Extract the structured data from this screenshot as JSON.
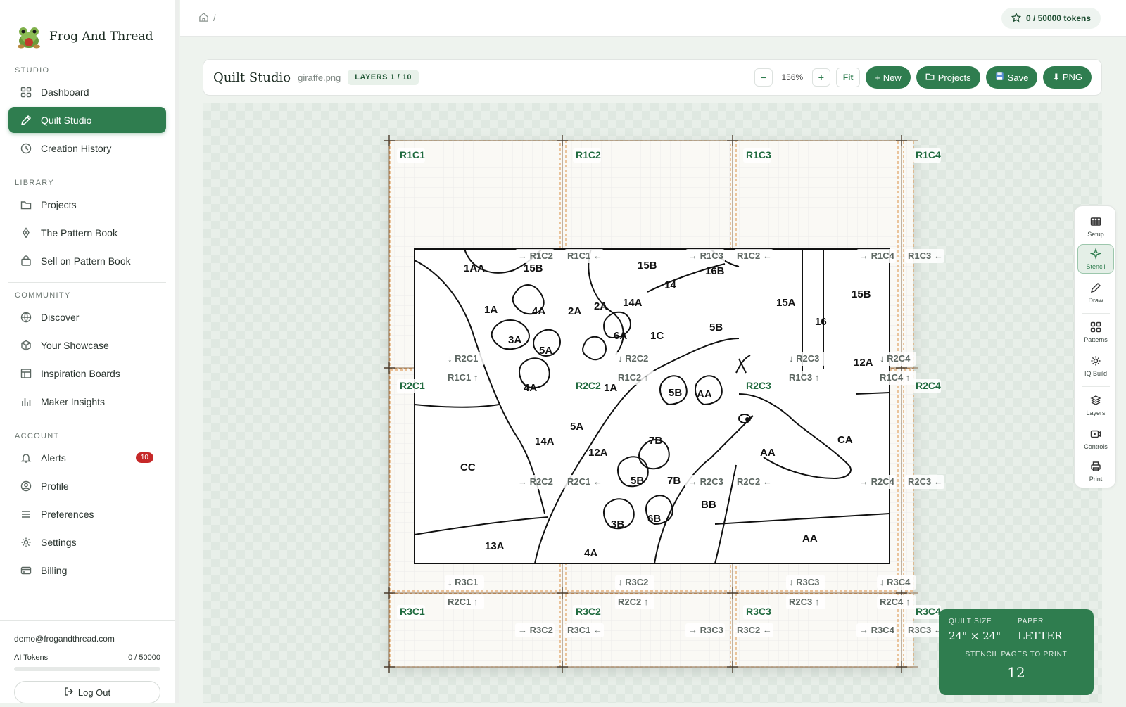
{
  "brand": {
    "name": "Frog And Thread"
  },
  "sidebar": {
    "studio_title": "STUDIO",
    "studio": [
      {
        "label": "Dashboard",
        "icon": "grid-icon"
      },
      {
        "label": "Quilt Studio",
        "icon": "pencil-icon",
        "active": true
      },
      {
        "label": "Creation History",
        "icon": "clock-icon"
      }
    ],
    "library_title": "LIBRARY",
    "library": [
      {
        "label": "Projects",
        "icon": "folder-icon"
      },
      {
        "label": "The Pattern Book",
        "icon": "pen-nib-icon"
      },
      {
        "label": "Sell on Pattern Book",
        "icon": "shop-bag-icon"
      }
    ],
    "community_title": "COMMUNITY",
    "community": [
      {
        "label": "Discover",
        "icon": "globe-icon"
      },
      {
        "label": "Your Showcase",
        "icon": "cube-icon"
      },
      {
        "label": "Inspiration Boards",
        "icon": "board-icon"
      },
      {
        "label": "Maker Insights",
        "icon": "bar-chart-icon"
      }
    ],
    "account_title": "ACCOUNT",
    "account": [
      {
        "label": "Alerts",
        "icon": "bell-icon",
        "badge": "10"
      },
      {
        "label": "Profile",
        "icon": "user-circle-icon"
      },
      {
        "label": "Preferences",
        "icon": "sliders-icon"
      },
      {
        "label": "Settings",
        "icon": "gear-icon"
      },
      {
        "label": "Billing",
        "icon": "credit-card-icon"
      }
    ],
    "email": "demo@frogandthread.com",
    "tokens_label": "AI Tokens",
    "tokens_value": "0 / 50000",
    "tokens_fraction": 0,
    "logout": "Log Out"
  },
  "topbar": {
    "crumb_sep": "/",
    "tokens": "0 / 50000 tokens"
  },
  "toolbar": {
    "title": "Quilt Studio",
    "file": "giraffe.png",
    "layers": "LAYERS 1 / 10",
    "zoom": "156%",
    "zoom_out": "−",
    "zoom_in": "+",
    "fit": "Fit",
    "new": "+ New",
    "projects": "Projects",
    "save": "Save",
    "png": "⬇ PNG"
  },
  "canvas": {
    "cells": [
      "R1C1",
      "R1C2",
      "R1C3",
      "R1C4",
      "R2C1",
      "R2C2",
      "R2C3",
      "R2C4",
      "R3C1",
      "R3C2",
      "R3C3",
      "R3C4"
    ],
    "nav_labels": [
      "→ R1C2",
      "R1C1 ←",
      "→ R1C3",
      "R1C2 ←",
      "→ R1C4",
      "R1C3 ←",
      "↓ R2C1",
      "↓ R2C2",
      "↓ R2C3",
      "↓ R2C4",
      "R1C1 ↑",
      "R1C2 ↑",
      "R1C3 ↑",
      "R1C4 ↑",
      "→ R2C2",
      "R2C1 ←",
      "→ R2C3",
      "R2C2 ←",
      "→ R2C4",
      "R2C3 ←",
      "↓ R3C1",
      "↓ R3C2",
      "↓ R3C3",
      "↓ R3C4",
      "R2C1 ↑",
      "R2C2 ↑",
      "R2C3 ↑",
      "R2C4 ↑",
      "→ R3C2",
      "R3C1 ←",
      "→ R3C3",
      "R3C2 ←",
      "→ R3C4",
      "R3C3 ←"
    ],
    "regions": [
      "1AA",
      "15B",
      "15B",
      "16B",
      "14",
      "14A",
      "2A",
      "2A",
      "1A",
      "4A",
      "3A",
      "5A",
      "6A",
      "1C",
      "5B",
      "15A",
      "16",
      "15B",
      "12A",
      "4A",
      "1A",
      "5B",
      "AA",
      "CA",
      "AA",
      "5A",
      "12A",
      "7B",
      "14A",
      "CC",
      "5B",
      "7B",
      "BB",
      "3B",
      "6B",
      "4A",
      "13A",
      "AA"
    ]
  },
  "rail": [
    {
      "label": "Setup",
      "icon": "table-icon"
    },
    {
      "label": "Stencil",
      "icon": "sparkle-icon",
      "active": true
    },
    {
      "label": "Draw",
      "icon": "pencil-icon"
    },
    {
      "label": "Patterns",
      "icon": "grid-icon"
    },
    {
      "label": "IQ Build",
      "icon": "sun-icon"
    },
    {
      "label": "Layers",
      "icon": "layers-icon"
    },
    {
      "label": "Controls",
      "icon": "controls-icon"
    },
    {
      "label": "Print",
      "icon": "printer-icon"
    }
  ],
  "summary": {
    "quilt_label": "QUILT SIZE",
    "quilt_value": "24\" × 24\"",
    "paper_label": "PAPER",
    "paper_value": "LETTER",
    "pages_label": "STENCIL PAGES TO PRINT",
    "pages_value": "12"
  },
  "colors": {
    "accent": "#2f7d4f",
    "badge": "#c62828",
    "guide": "#e0a060"
  }
}
